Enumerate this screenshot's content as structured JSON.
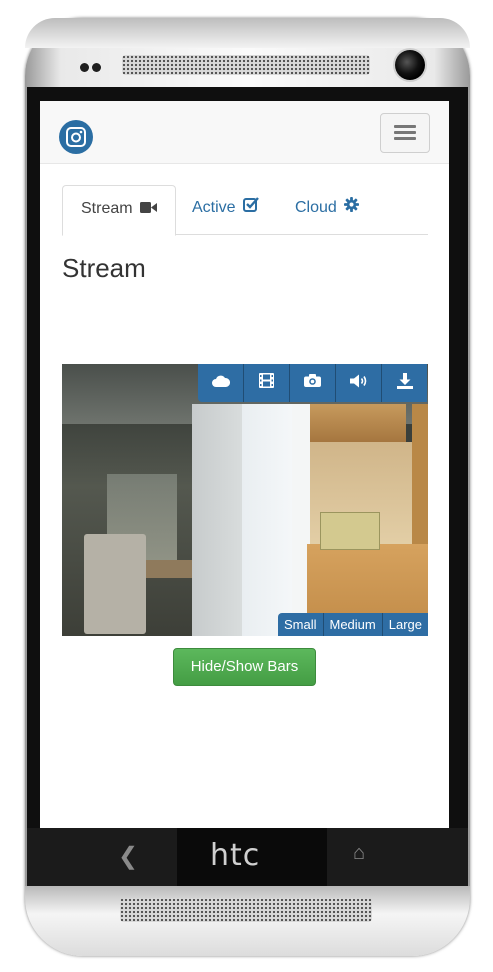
{
  "navbar": {
    "logo_icon": "instagram-camera-icon",
    "menu_icon": "hamburger-menu-icon"
  },
  "tabs": [
    {
      "label": "Stream",
      "icon": "video-camera-icon",
      "active": true
    },
    {
      "label": "Active",
      "icon": "checkbox-check-icon",
      "active": false
    },
    {
      "label": "Cloud",
      "icon": "gear-icon",
      "active": false
    }
  ],
  "page": {
    "heading": "Stream"
  },
  "video_controls": {
    "top_buttons": [
      {
        "icon": "cloud-icon"
      },
      {
        "icon": "film-icon"
      },
      {
        "icon": "camera-icon"
      },
      {
        "icon": "volume-icon"
      },
      {
        "icon": "download-icon"
      }
    ],
    "size_buttons": [
      "Small",
      "Medium",
      "Large"
    ]
  },
  "actions": {
    "hide_show_bars": "Hide/Show Bars"
  },
  "device": {
    "brand": "htc",
    "colors": {
      "primary": "#2e6da4",
      "success": "#5cb85c",
      "link": "#2b6ea3"
    }
  }
}
